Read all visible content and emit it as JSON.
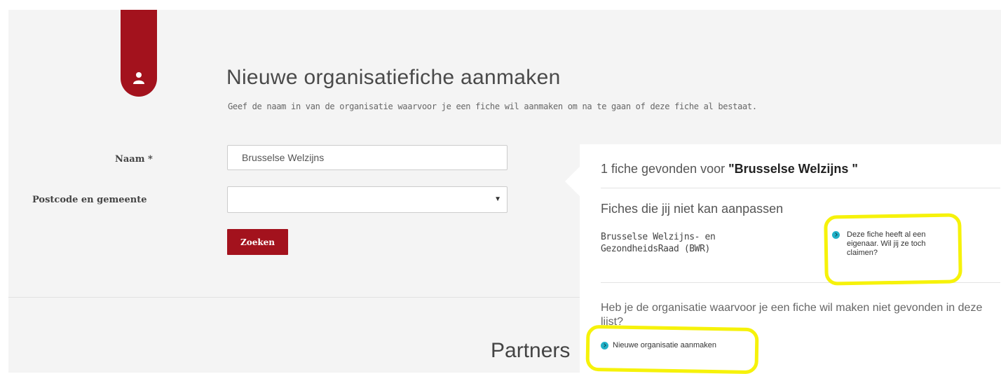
{
  "heading": {
    "title": "Nieuwe organisatiefiche aanmaken",
    "subtitle": "Geef de naam in van de organisatie waarvoor je een fiche wil aanmaken om na te gaan of deze fiche al bestaat."
  },
  "form": {
    "naam_label": "Naam *",
    "naam_value": "Brusselse Welzijns",
    "postcode_label": "Postcode en gemeente",
    "postcode_value": "",
    "search_button": "Zoeken"
  },
  "results": {
    "found_prefix": "1 fiche gevonden voor ",
    "found_query": "\"Brusselse Welzijns \"",
    "section_title": "Fiches die jij niet kan aanpassen",
    "org_name": "Brusselse Welzijns- en GezondheidsRaad (BWR)",
    "claim_link": "Deze fiche heeft al een eigenaar. Wil jij ze toch claimen?",
    "not_found_question": "Heb je de organisatie waarvoor je een fiche wil maken niet gevonden in deze lijst?",
    "new_org_link": "Nieuwe organisatie aanmaken"
  },
  "footer": {
    "partners": "Partners"
  },
  "colors": {
    "brand_red": "#a3121d",
    "link_bullet": "#21b1c8",
    "highlight_yellow": "#f6f20a",
    "page_background": "#f4f4f4"
  },
  "icons": {
    "bookmark": "user-icon",
    "link_bullet": "chevron-right-circle-icon",
    "select": "caret-down-icon"
  }
}
